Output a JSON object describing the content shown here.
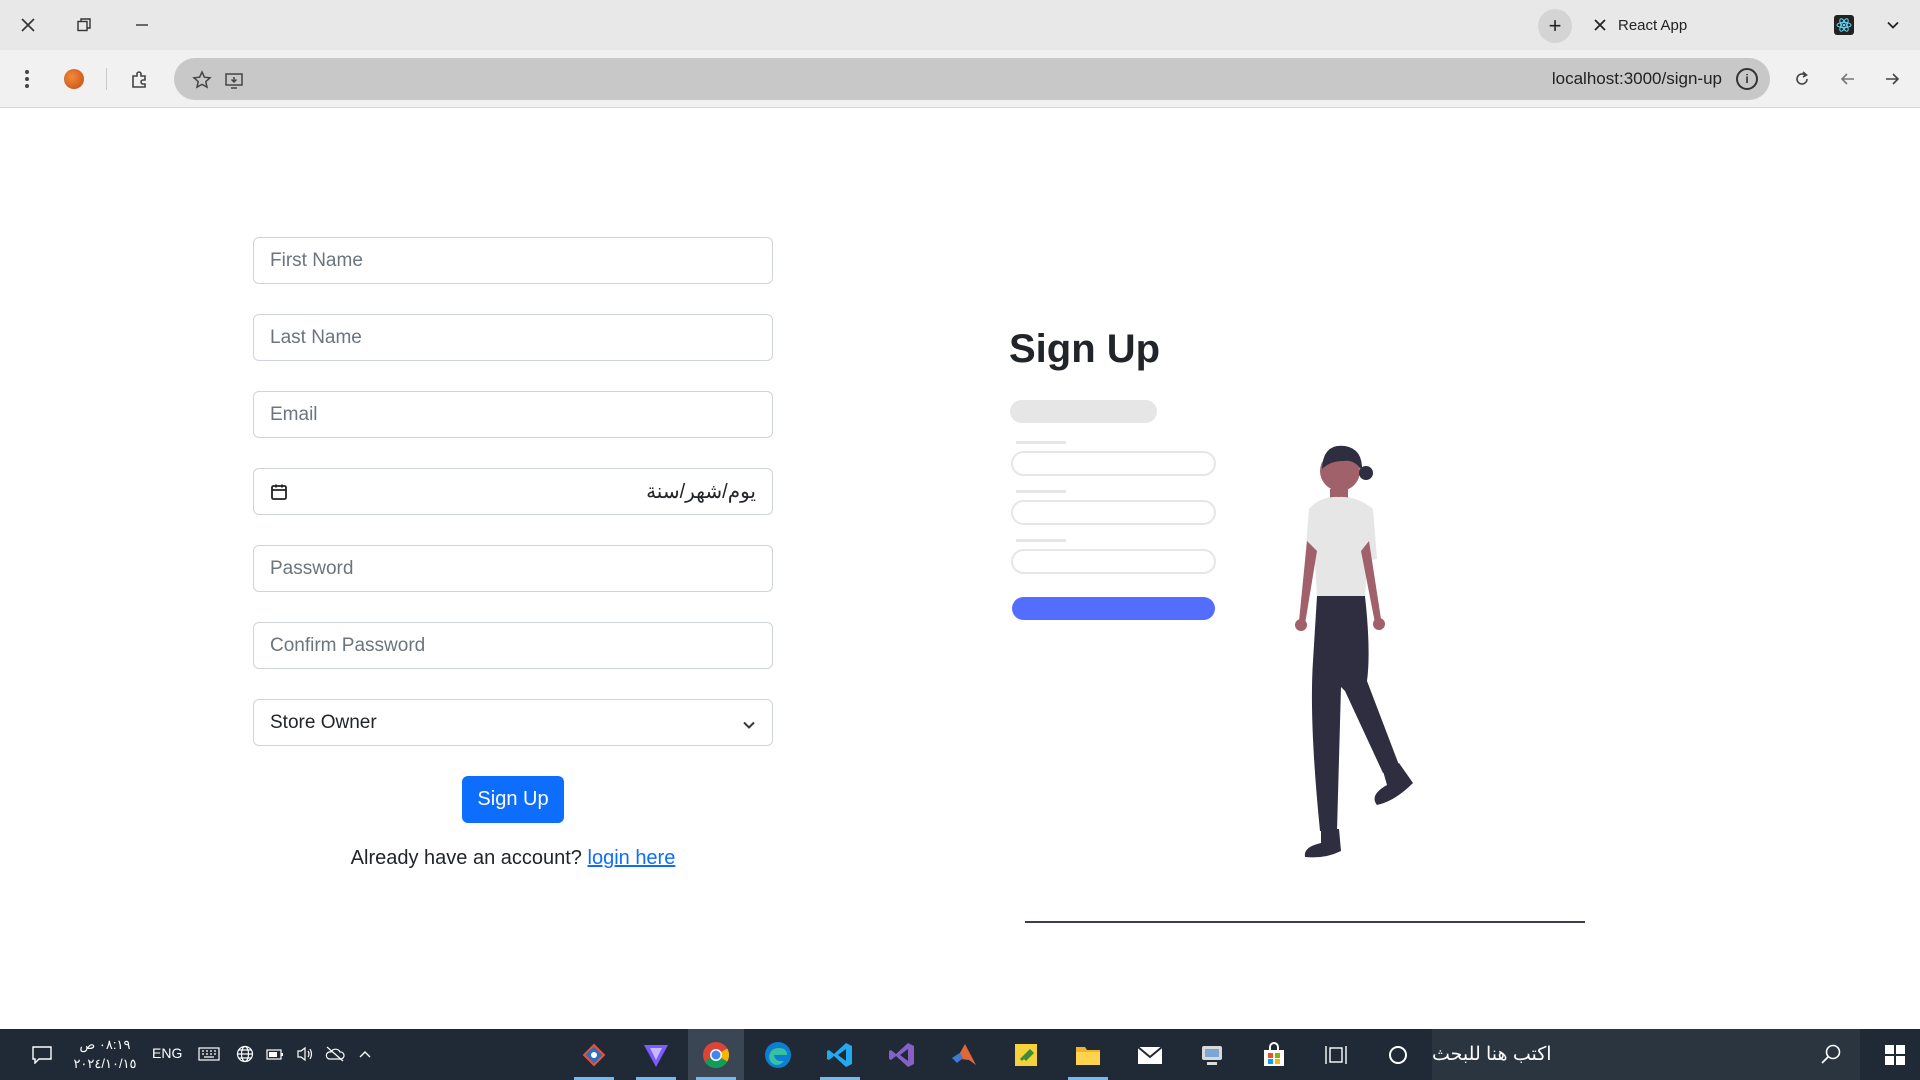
{
  "browser": {
    "tab_title": "React App",
    "url": "localhost:3000/sign-up"
  },
  "form": {
    "first_name_placeholder": "First Name",
    "last_name_placeholder": "Last Name",
    "email_placeholder": "Email",
    "date_value": "يوم/شهر/سنة",
    "password_placeholder": "Password",
    "confirm_password_placeholder": "Confirm Password",
    "role_selected": "Store Owner",
    "submit_label": "Sign Up",
    "login_prompt": "Already have an account?",
    "login_link": "login here"
  },
  "hero": {
    "heading": "Sign Up"
  },
  "taskbar": {
    "time": "٠٨:١٩ ص",
    "date": "٢٠٢٤/١٠/١٥",
    "language": "ENG",
    "search_placeholder": "اكتب هنا للبحث",
    "apps": [
      "git-icon",
      "vite-icon",
      "chrome-icon",
      "edge-icon",
      "vscode-icon",
      "visual-studio-icon",
      "matlab-icon",
      "sticky-notes-icon",
      "file-explorer-icon",
      "mail-icon",
      "network-icon",
      "store-icon",
      "task-view-icon",
      "cortana-icon"
    ]
  },
  "colors": {
    "primary": "#0d6efd",
    "illustration_accent": "#536dfe",
    "taskbar": "#1f2a36"
  }
}
